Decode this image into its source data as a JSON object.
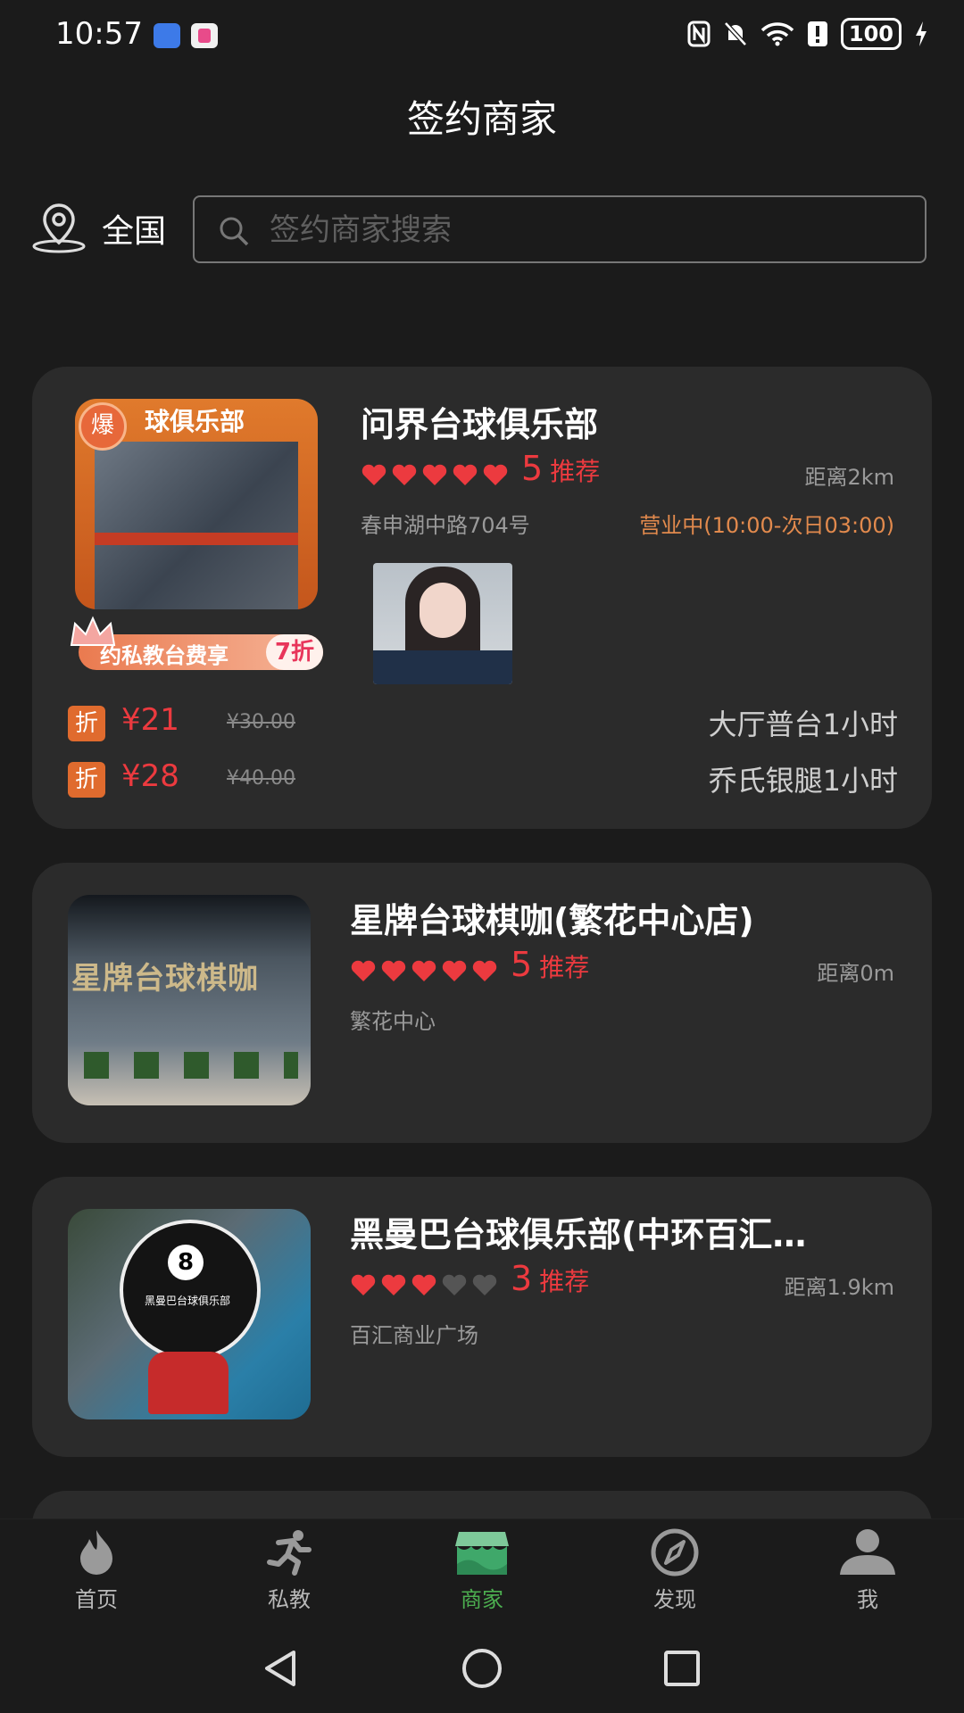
{
  "status_bar": {
    "time": "10:57",
    "battery": "100"
  },
  "header": {
    "title": "签约商家"
  },
  "search": {
    "region": "全国",
    "placeholder": "签约商家搜索"
  },
  "merchants": [
    {
      "name": "问界台球俱乐部",
      "stars_filled": 5,
      "rating": "5",
      "recommend": "推荐",
      "distance": "距离2km",
      "address": "春申湖中路704号",
      "hours": "营业中(10:00-次日03:00)",
      "photo_text": "球俱乐部",
      "hot_badge": "爆",
      "promo": {
        "text": "约私教台费享",
        "discount": "7折"
      },
      "deals": [
        {
          "tag": "折",
          "price": "¥21",
          "original": "¥30.00",
          "name": "大厅普台1小时"
        },
        {
          "tag": "折",
          "price": "¥28",
          "original": "¥40.00",
          "name": "乔氏银腿1小时"
        }
      ]
    },
    {
      "name": "星牌台球棋咖(繁花中心店)",
      "stars_filled": 5,
      "rating": "5",
      "recommend": "推荐",
      "distance": "距离0m",
      "address": "繁花中心",
      "photo_text": "星牌台球棋咖"
    },
    {
      "name": "黑曼巴台球俱乐部(中环百汇…",
      "stars_filled": 3,
      "rating": "3",
      "recommend": "推荐",
      "distance": "距离1.9km",
      "address": "百汇商业广场",
      "photo_text": "黑曼巴台球俱乐部"
    }
  ],
  "tabs": [
    {
      "label": "首页",
      "icon": "flame-icon"
    },
    {
      "label": "私教",
      "icon": "runner-icon"
    },
    {
      "label": "商家",
      "icon": "store-icon",
      "active": true
    },
    {
      "label": "发现",
      "icon": "compass-icon"
    },
    {
      "label": "我",
      "icon": "user-icon"
    }
  ],
  "colors": {
    "accent_red": "#ec3a3f",
    "accent_green": "#4caf50",
    "hours_orange": "#e28a4d",
    "card_bg": "#2b2b2b"
  }
}
